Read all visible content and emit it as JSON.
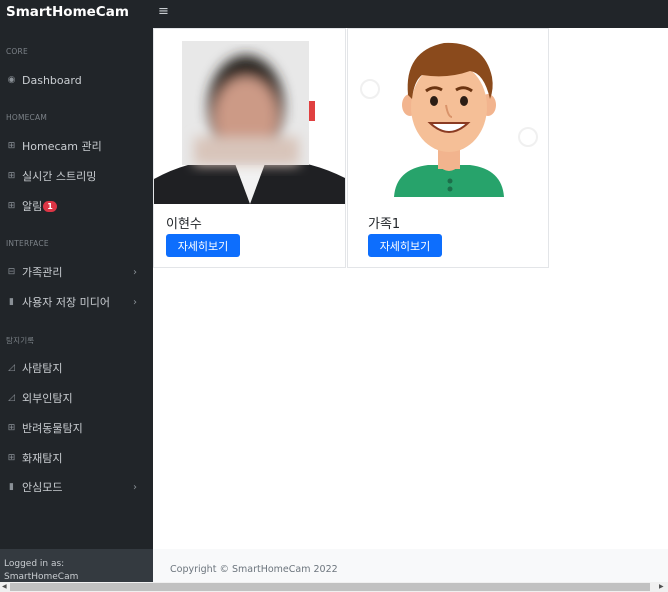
{
  "brand": "SmartHomeCam",
  "sidebar": {
    "headings": [
      "CORE",
      "HOMECAM",
      "INTERFACE",
      "탐지기록"
    ],
    "items": [
      {
        "label": "Dashboard"
      },
      {
        "label": "Homecam 관리"
      },
      {
        "label": "실시간 스트리밍"
      },
      {
        "label": "알림",
        "badge": "1"
      },
      {
        "label": "가족관리"
      },
      {
        "label": "사용자 저장 미디어"
      },
      {
        "label": "사람탐지"
      },
      {
        "label": "외부인탐지"
      },
      {
        "label": "반려동물탐지"
      },
      {
        "label": "화재탐지"
      },
      {
        "label": "안심모드"
      }
    ],
    "footer_label": "Logged in as:",
    "footer_user": "SmartHomeCam"
  },
  "cards": [
    {
      "name": "이현수",
      "button": "자세히보기"
    },
    {
      "name": "가족1",
      "button": "자세히보기"
    }
  ],
  "footer": {
    "copyright": "Copyright © SmartHomeCam 2022"
  }
}
